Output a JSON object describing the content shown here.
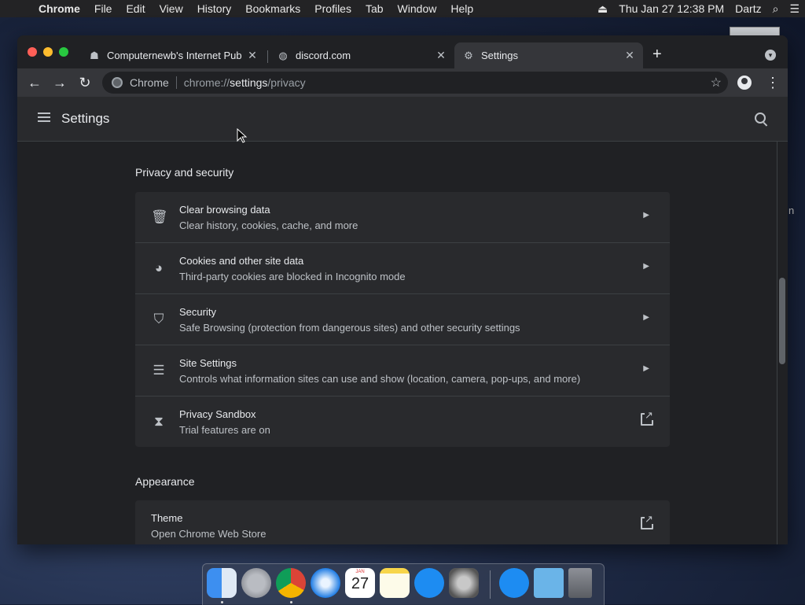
{
  "menubar": {
    "app_name": "Chrome",
    "items": [
      "File",
      "Edit",
      "View",
      "History",
      "Bookmarks",
      "Profiles",
      "Tab",
      "Window",
      "Help"
    ],
    "datetime": "Thu Jan 27  12:38 PM",
    "user": "Dartz"
  },
  "tabs": [
    {
      "title": "Computernewb's Internet Pub",
      "icon": "pub-icon",
      "active": false
    },
    {
      "title": "discord.com",
      "icon": "globe-icon",
      "active": false
    },
    {
      "title": "Settings",
      "icon": "gear-icon",
      "active": true
    }
  ],
  "omnibox": {
    "chip": "Chrome",
    "url_scheme": "chrome://",
    "url_host": "settings",
    "url_path": "/privacy"
  },
  "settings": {
    "title": "Settings",
    "privacy_section": {
      "title": "Privacy and security",
      "rows": [
        {
          "title": "Clear browsing data",
          "subtitle": "Clear history, cookies, cache, and more",
          "icon": "trash-icon",
          "action": "chevron"
        },
        {
          "title": "Cookies and other site data",
          "subtitle": "Third-party cookies are blocked in Incognito mode",
          "icon": "cookie-icon",
          "action": "chevron"
        },
        {
          "title": "Security",
          "subtitle": "Safe Browsing (protection from dangerous sites) and other security settings",
          "icon": "shield-icon",
          "action": "chevron"
        },
        {
          "title": "Site Settings",
          "subtitle": "Controls what information sites can use and show (location, camera, pop-ups, and more)",
          "icon": "sliders-icon",
          "action": "chevron"
        },
        {
          "title": "Privacy Sandbox",
          "subtitle": "Trial features are on",
          "icon": "flask-icon",
          "action": "external"
        }
      ]
    },
    "appearance_section": {
      "title": "Appearance",
      "rows": [
        {
          "title": "Theme",
          "subtitle": "Open Chrome Web Store",
          "action": "external"
        }
      ]
    }
  },
  "dock": {
    "calendar_month": "JAN",
    "calendar_day": "27"
  },
  "desktop_fragment": "n"
}
